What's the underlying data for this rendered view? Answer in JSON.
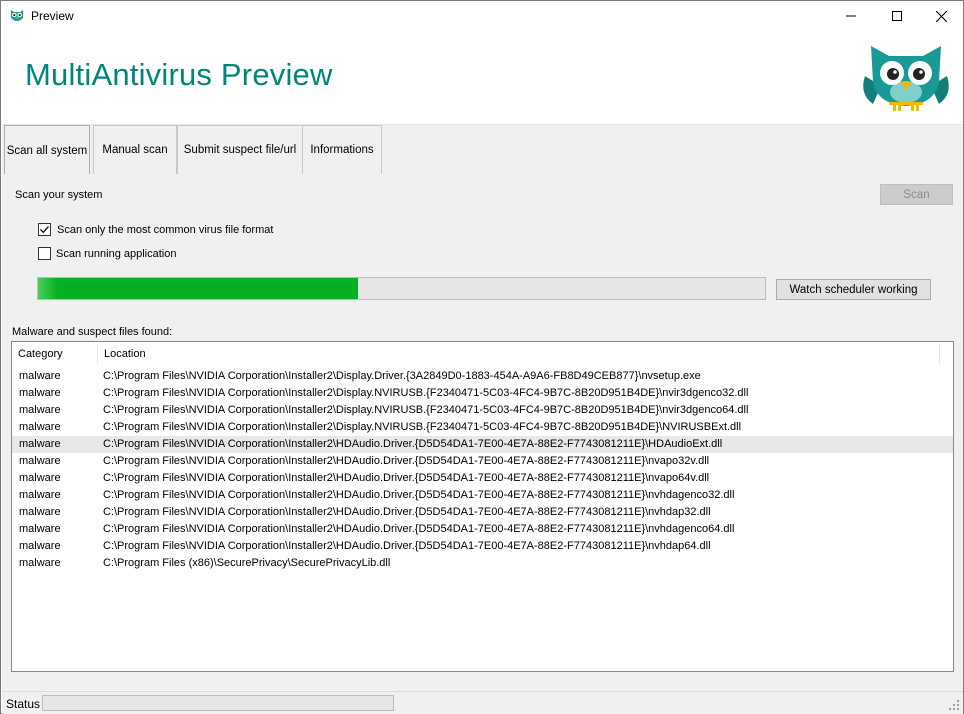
{
  "window": {
    "title": "Preview",
    "minimize_icon": "minimize-icon",
    "maximize_icon": "maximize-icon",
    "close_icon": "close-icon"
  },
  "header": {
    "title": "MultiAntivirus Preview",
    "logo_icon": "owl-logo-icon"
  },
  "tabs": [
    {
      "label": "Scan all system",
      "active": true
    },
    {
      "label": "Manual scan",
      "active": false
    },
    {
      "label": "Submit suspect file/url",
      "active": false
    },
    {
      "label": "Informations",
      "active": false
    }
  ],
  "scan": {
    "section_label": "Scan your system",
    "scan_button": "Scan",
    "option_common_formats": {
      "label": "Scan only the most common virus file format",
      "checked": true
    },
    "option_running_apps": {
      "label": "Scan running application",
      "checked": false
    },
    "progress_percent": 44,
    "scheduler_button": "Watch scheduler working"
  },
  "results": {
    "label": "Malware and suspect files found:",
    "columns": [
      "Category",
      "Location"
    ],
    "rows": [
      {
        "category": "malware",
        "location": "C:\\Program Files\\NVIDIA Corporation\\Installer2\\Display.Driver.{3A2849D0-1883-454A-A9A6-FB8D49CEB877}\\nvsetup.exe"
      },
      {
        "category": "malware",
        "location": "C:\\Program Files\\NVIDIA Corporation\\Installer2\\Display.NVIRUSB.{F2340471-5C03-4FC4-9B7C-8B20D951B4DE}\\nvir3dgenco32.dll"
      },
      {
        "category": "malware",
        "location": "C:\\Program Files\\NVIDIA Corporation\\Installer2\\Display.NVIRUSB.{F2340471-5C03-4FC4-9B7C-8B20D951B4DE}\\nvir3dgenco64.dll"
      },
      {
        "category": "malware",
        "location": "C:\\Program Files\\NVIDIA Corporation\\Installer2\\Display.NVIRUSB.{F2340471-5C03-4FC4-9B7C-8B20D951B4DE}\\NVIRUSBExt.dll"
      },
      {
        "category": "malware",
        "location": "C:\\Program Files\\NVIDIA Corporation\\Installer2\\HDAudio.Driver.{D5D54DA1-7E00-4E7A-88E2-F7743081211E}\\HDAudioExt.dll",
        "hover": true
      },
      {
        "category": "malware",
        "location": "C:\\Program Files\\NVIDIA Corporation\\Installer2\\HDAudio.Driver.{D5D54DA1-7E00-4E7A-88E2-F7743081211E}\\nvapo32v.dll"
      },
      {
        "category": "malware",
        "location": "C:\\Program Files\\NVIDIA Corporation\\Installer2\\HDAudio.Driver.{D5D54DA1-7E00-4E7A-88E2-F7743081211E}\\nvapo64v.dll"
      },
      {
        "category": "malware",
        "location": "C:\\Program Files\\NVIDIA Corporation\\Installer2\\HDAudio.Driver.{D5D54DA1-7E00-4E7A-88E2-F7743081211E}\\nvhdagenco32.dll"
      },
      {
        "category": "malware",
        "location": "C:\\Program Files\\NVIDIA Corporation\\Installer2\\HDAudio.Driver.{D5D54DA1-7E00-4E7A-88E2-F7743081211E}\\nvhdap32.dll"
      },
      {
        "category": "malware",
        "location": "C:\\Program Files\\NVIDIA Corporation\\Installer2\\HDAudio.Driver.{D5D54DA1-7E00-4E7A-88E2-F7743081211E}\\nvhdagenco64.dll"
      },
      {
        "category": "malware",
        "location": "C:\\Program Files\\NVIDIA Corporation\\Installer2\\HDAudio.Driver.{D5D54DA1-7E00-4E7A-88E2-F7743081211E}\\nvhdap64.dll"
      },
      {
        "category": "malware",
        "location": "C:\\Program Files (x86)\\SecurePrivacy\\SecurePrivacyLib.dll"
      }
    ]
  },
  "status": {
    "label": "Status",
    "progress_percent": 0,
    "grip_icon": "resize-grip-icon"
  },
  "colors": {
    "brand": "#00857c",
    "progress": "#06b025",
    "owl_body": "#1a9a96",
    "owl_beak": "#f5b800"
  }
}
